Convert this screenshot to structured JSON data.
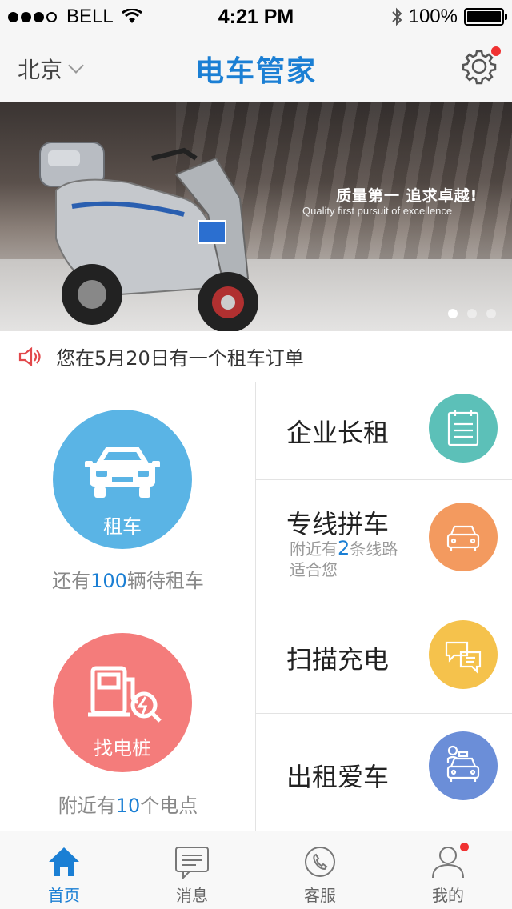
{
  "status_bar": {
    "carrier": "BELL",
    "time": "4:21 PM",
    "battery": "100%"
  },
  "navbar": {
    "city": "北京",
    "title": "电车管家"
  },
  "banner": {
    "slogan_cn": "质量第一 追求卓越!",
    "slogan_en": "Quality first pursuit of excellence"
  },
  "notice": {
    "text": "您在5月20日有一个租车订单"
  },
  "rent": {
    "label": "租车",
    "sub_prefix": "还有",
    "sub_count": "100",
    "sub_suffix": "辆待租车"
  },
  "charger": {
    "label": "找电桩",
    "sub_prefix": "附近有",
    "sub_count": "10",
    "sub_suffix": "个电点"
  },
  "services": {
    "enterprise": {
      "title": "企业长租"
    },
    "carpool": {
      "title": "专线拼车",
      "desc_prefix": "附近有",
      "desc_count": "2",
      "desc_suffix": "条线路",
      "desc_line2": "适合您"
    },
    "scan": {
      "title": "扫描充电"
    },
    "lease": {
      "title": "出租爱车"
    }
  },
  "tabs": [
    {
      "label": "首页"
    },
    {
      "label": "消息"
    },
    {
      "label": "客服"
    },
    {
      "label": "我的"
    }
  ],
  "colors": {
    "brand": "#1b7fd4",
    "rent_circle": "#5ab4e5",
    "charger_circle": "#f47c7b",
    "enterprise": "#5cc0b8",
    "carpool": "#f39a5f",
    "scan": "#f5c24c",
    "lease": "#6b8ed8"
  },
  "icons": {
    "navbar": [
      "chevron-down-icon",
      "gear-icon"
    ],
    "tabs": [
      "home-icon",
      "message-icon",
      "phone-icon",
      "user-icon"
    ]
  }
}
